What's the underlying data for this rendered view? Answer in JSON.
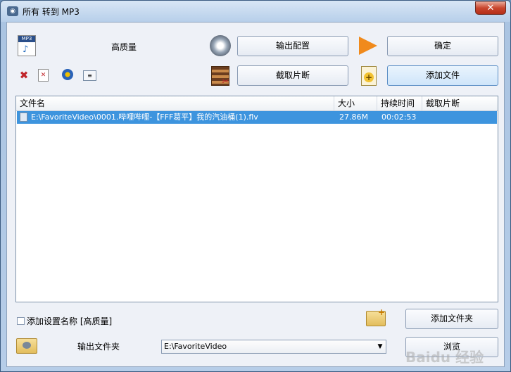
{
  "window": {
    "title": "所有 转到 MP3",
    "close_label": "✕"
  },
  "format": {
    "icon_label": "MP3",
    "quality": "高质量"
  },
  "buttons": {
    "output_config": "输出配置",
    "ok": "确定",
    "clip": "截取片断",
    "add_file": "添加文件",
    "add_folder": "添加文件夹",
    "browse": "浏览"
  },
  "list": {
    "columns": [
      "文件名",
      "大小",
      "持续时间",
      "截取片断"
    ],
    "rows": [
      {
        "name": "E:\\FavoriteVideo\\0001.哔哩哔哩-【FFF葛平】我的汽油桶(1).flv",
        "size": "27.86M",
        "duration": "00:02:53",
        "clip": ""
      }
    ]
  },
  "options": {
    "add_setting_name_label": "添加设置名称 [高质量]",
    "add_setting_name_checked": false,
    "output_folder_label": "输出文件夹",
    "output_folder_value": "E:\\FavoriteVideo"
  },
  "watermark": "Baidu 经验",
  "colors": {
    "selection": "#3d94de",
    "close_button": "#c8452d"
  }
}
